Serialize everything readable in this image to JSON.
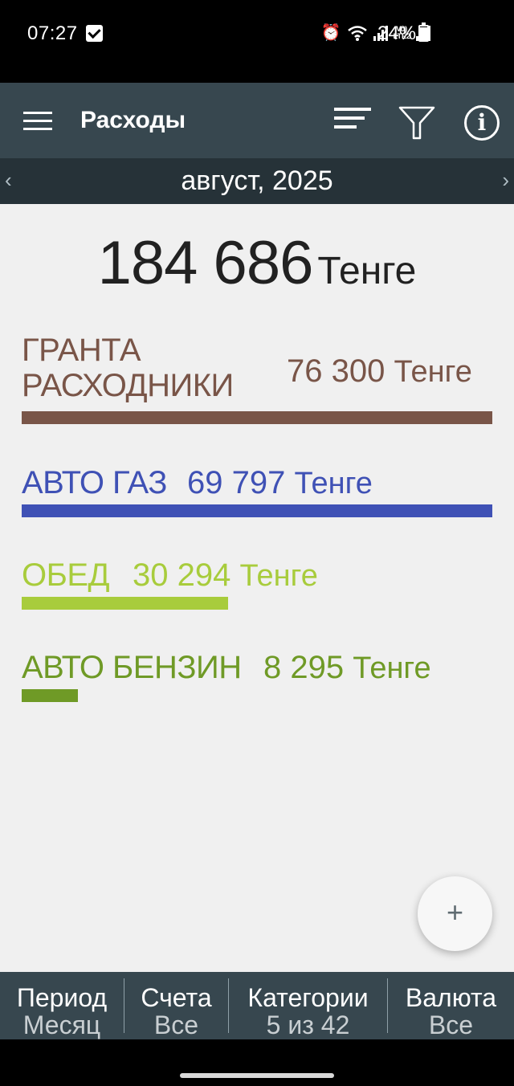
{
  "status": {
    "time": "07:27",
    "network": "LTE2",
    "battery": "24%"
  },
  "toolbar": {
    "title": "Расходы",
    "icons": [
      "menu-icon",
      "sort-icon",
      "filter-icon",
      "info-icon"
    ]
  },
  "period": {
    "label": "август, 2025",
    "prev": "‹",
    "next": "›"
  },
  "summary": {
    "total": "184 686",
    "currency": "Тенге"
  },
  "categories": [
    {
      "name_line1": "ГРАНТА",
      "name_line2": "РАСХОДНИКИ",
      "amount": "76 300",
      "currency": "Тенге",
      "color": "#795548",
      "share": 1.0
    },
    {
      "name": "АВТО ГАЗ",
      "amount": "69 797",
      "currency": "Тенге",
      "color": "#3f51b5",
      "share": 0.915
    },
    {
      "name": "ОБЕД",
      "amount": "30 294",
      "currency": "Тенге",
      "color": "#a8cc3c",
      "share": 0.397
    },
    {
      "name": "АВТО БЕНЗИН",
      "amount": "8 295",
      "currency": "Тенге",
      "color": "#6f9a26",
      "share": 0.109
    }
  ],
  "fab": {
    "label": "+"
  },
  "tabs": [
    {
      "title": "Период",
      "value": "Месяц"
    },
    {
      "title": "Счета",
      "value": "Все"
    },
    {
      "title": "Категории",
      "value": "5 из 42"
    },
    {
      "title": "Валюта",
      "value": "Все"
    }
  ]
}
